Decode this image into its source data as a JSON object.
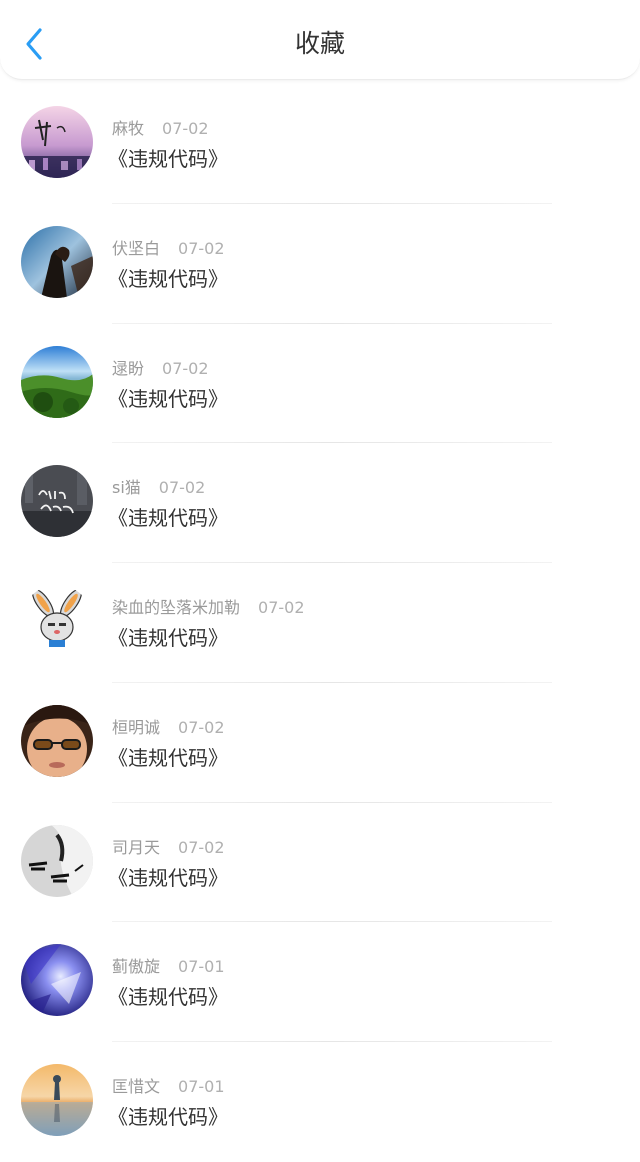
{
  "header": {
    "title": "收藏",
    "back_icon": "chevron-left-icon",
    "accent_color": "#2a9df4"
  },
  "items": [
    {
      "user": "麻牧",
      "date": "07-02",
      "title": "《违规代码》"
    },
    {
      "user": "伏坚白",
      "date": "07-02",
      "title": "《违规代码》"
    },
    {
      "user": "逯盼",
      "date": "07-02",
      "title": "《违规代码》"
    },
    {
      "user": "si猫",
      "date": "07-02",
      "title": "《违规代码》"
    },
    {
      "user": "染血的坠落米加勒",
      "date": "07-02",
      "title": "《违规代码》"
    },
    {
      "user": "桓明诚",
      "date": "07-02",
      "title": "《违规代码》"
    },
    {
      "user": "司月天",
      "date": "07-02",
      "title": "《违规代码》"
    },
    {
      "user": "蓟傲旋",
      "date": "07-01",
      "title": "《违规代码》"
    },
    {
      "user": "匡惜文",
      "date": "07-01",
      "title": "《违规代码》"
    }
  ]
}
